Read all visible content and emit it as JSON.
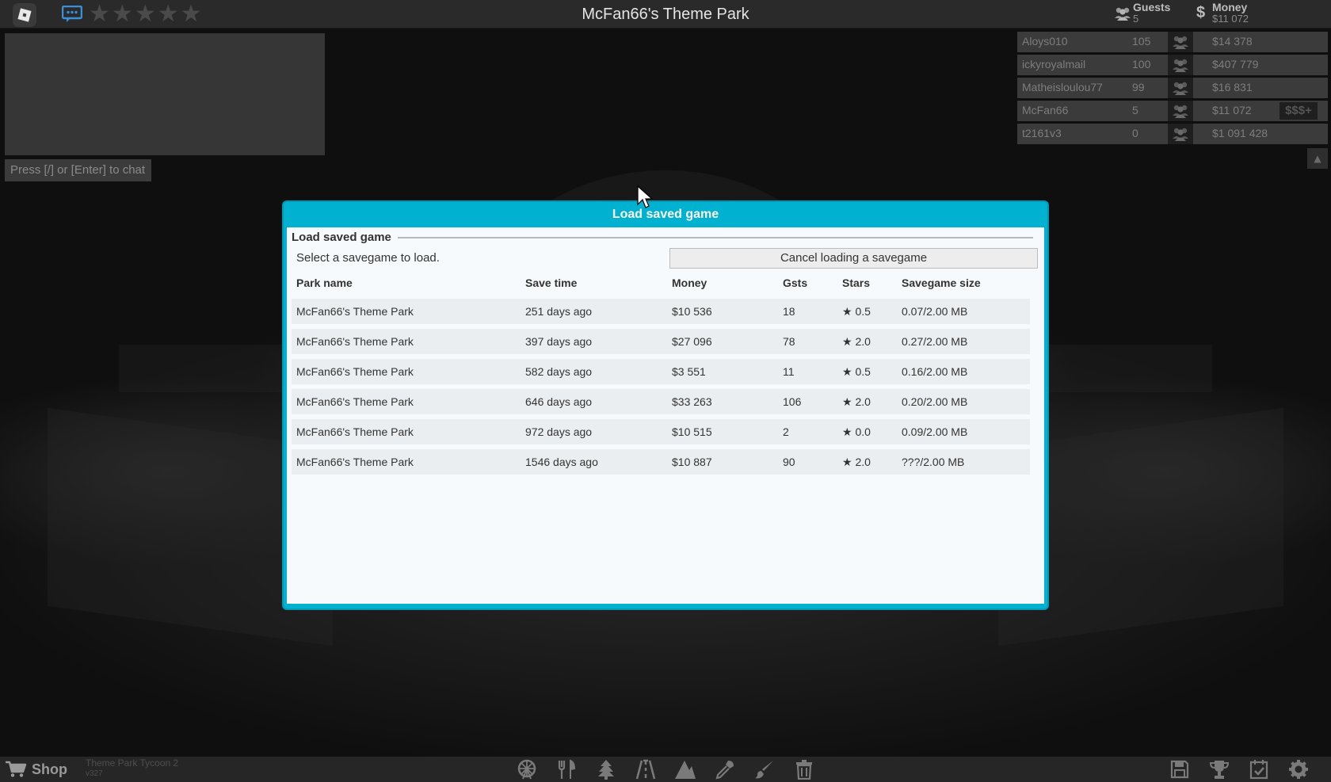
{
  "topbar": {
    "park_title": "McFan66's Theme Park",
    "rating_stars": 0,
    "guests_label": "Guests",
    "guests_value": "5",
    "money_label": "Money",
    "money_value": "$11 072"
  },
  "chat": {
    "hint": "Press [/] or [Enter] to chat"
  },
  "players": [
    {
      "name": "Aloys010",
      "guests": "105",
      "money": "$14 378",
      "donate": ""
    },
    {
      "name": "ickyroyalmail",
      "guests": "100",
      "money": "$407 779",
      "donate": ""
    },
    {
      "name": "Matheisloulou77",
      "guests": "99",
      "money": "$16 831",
      "donate": ""
    },
    {
      "name": "McFan66",
      "guests": "5",
      "money": "$11 072",
      "donate": "$$$+"
    },
    {
      "name": "t2161v3",
      "guests": "0",
      "money": "$1 091 428",
      "donate": ""
    }
  ],
  "dialog": {
    "header": "Load saved game",
    "section_title": "Load saved game",
    "instruction": "Select a savegame to load.",
    "cancel_label": "Cancel loading a savegame",
    "columns": {
      "name": "Park name",
      "time": "Save time",
      "money": "Money",
      "gsts": "Gsts",
      "stars": "Stars",
      "size": "Savegame size"
    },
    "saves": [
      {
        "name": "McFan66's Theme Park",
        "time": "251 days ago",
        "money": "$10 536",
        "gsts": "18",
        "stars": "★ 0.5",
        "size": "0.07/2.00 MB"
      },
      {
        "name": "McFan66's Theme Park",
        "time": "397 days ago",
        "money": "$27 096",
        "gsts": "78",
        "stars": "★ 2.0",
        "size": "0.27/2.00 MB"
      },
      {
        "name": "McFan66's Theme Park",
        "time": "582 days ago",
        "money": "$3 551",
        "gsts": "11",
        "stars": "★ 0.5",
        "size": "0.16/2.00 MB"
      },
      {
        "name": "McFan66's Theme Park",
        "time": "646 days ago",
        "money": "$33 263",
        "gsts": "106",
        "stars": "★ 2.0",
        "size": "0.20/2.00 MB"
      },
      {
        "name": "McFan66's Theme Park",
        "time": "972 days ago",
        "money": "$10 515",
        "gsts": "2",
        "stars": "★ 0.0",
        "size": "0.09/2.00 MB"
      },
      {
        "name": "McFan66's Theme Park",
        "time": "1546 days ago",
        "money": "$10 887",
        "gsts": "90",
        "stars": "★ 2.0",
        "size": "???/2.00 MB"
      }
    ]
  },
  "bottombar": {
    "shop_label": "Shop",
    "game_name": "Theme Park Tycoon 2",
    "version": "v327",
    "build_tools": [
      "ferris-wheel-icon",
      "food-icon",
      "tree-icon",
      "path-icon",
      "terrain-icon",
      "eyedropper-icon",
      "paint-brush-icon",
      "trash-icon"
    ],
    "menu_tools": [
      "save-icon",
      "trophy-icon",
      "calendar-check-icon",
      "gear-icon"
    ]
  },
  "colors": {
    "dialog_accent": "#00b2d0",
    "topbar_bg": "#2a2a2a"
  }
}
